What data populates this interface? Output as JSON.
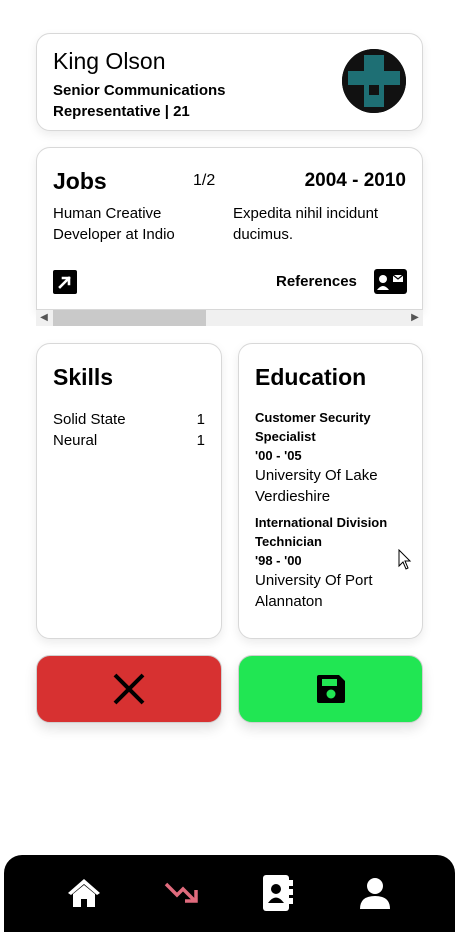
{
  "profile": {
    "name": "King Olson",
    "title": "Senior Communications Representative | 21",
    "avatar_icon": "identicon-avatar"
  },
  "jobs": {
    "heading": "Jobs",
    "pager": "1/2",
    "years": "2004 - 2010",
    "role": "Human Creative Developer at Indio",
    "description": "Expedita nihil incidunt ducimus.",
    "open_icon": "external-link-icon",
    "references_label": "References",
    "references_icon": "contact-card-icon"
  },
  "skills": {
    "heading": "Skills",
    "items": [
      {
        "name": "Solid State",
        "level": "1"
      },
      {
        "name": "Neural",
        "level": "1"
      }
    ]
  },
  "education": {
    "heading": "Education",
    "items": [
      {
        "title": "Customer Security Specialist",
        "years": "'00 - '05",
        "school": "University Of Lake Verdieshire"
      },
      {
        "title": "International Division Technician",
        "years": "'98 - '00",
        "school": "University Of Port Alannaton"
      }
    ]
  },
  "actions": {
    "cancel_icon": "close-icon",
    "save_icon": "floppy-disk-icon",
    "cancel_color": "#d73131",
    "save_color": "#21e653"
  },
  "nav": {
    "items": [
      {
        "icon": "home-icon",
        "active": false
      },
      {
        "icon": "trending-down-icon",
        "active": true
      },
      {
        "icon": "address-book-icon",
        "active": false
      },
      {
        "icon": "user-icon",
        "active": false
      }
    ],
    "accent_color": "#e06b7d"
  }
}
